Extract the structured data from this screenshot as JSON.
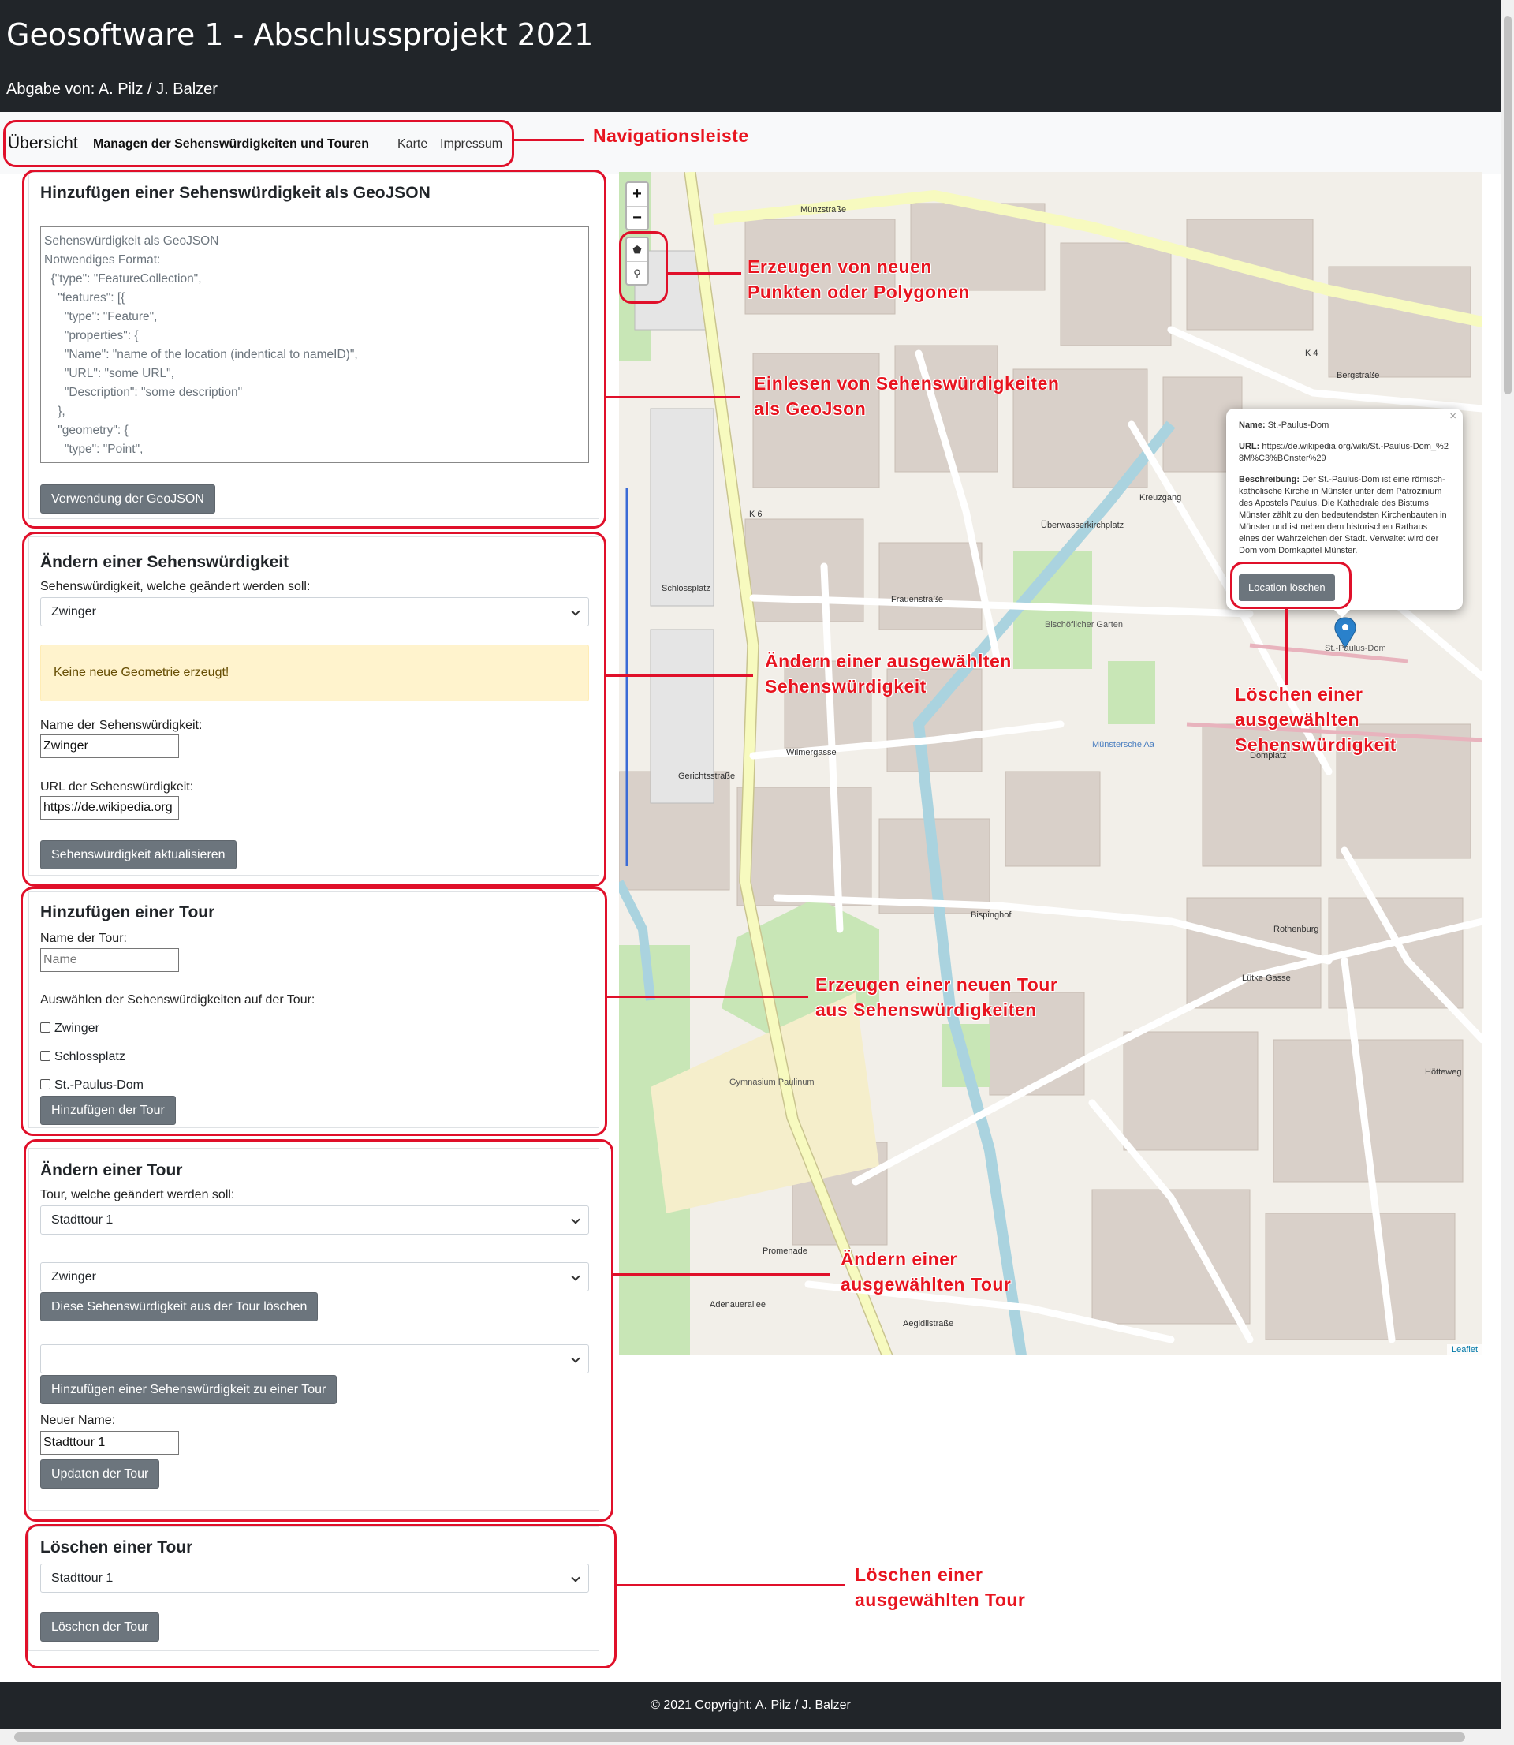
{
  "header": {
    "title": "Geosoftware 1 - Abschlussprojekt 2021",
    "subtitle": "Abgabe von: A. Pilz / J. Balzer"
  },
  "nav": {
    "brand": "Übersicht",
    "items": [
      {
        "label": "Managen der Sehenswürdigkeiten und Touren",
        "active": true
      },
      {
        "label": "Karte",
        "active": false
      },
      {
        "label": "Impressum",
        "active": false
      }
    ]
  },
  "add_sight": {
    "title": "Hinzufügen einer Sehenswürdigkeit als GeoJSON",
    "placeholder": "Sehenswürdigkeit als GeoJSON\nNotwendiges Format:\n  {\"type\": \"FeatureCollection\",\n    \"features\": [{\n      \"type\": \"Feature\",\n      \"properties\": {\n      \"Name\": \"name of the location (indentical to nameID)\",\n      \"URL\": \"some URL\",\n      \"Description\": \"some description\"\n    },\n    \"geometry\": {\n      \"type\": \"Point\",",
    "button": "Verwendung der GeoJSON"
  },
  "edit_sight": {
    "title": "Ändern einer Sehenswürdigkeit",
    "select_label": "Sehenswürdigkeit, welche geändert werden soll:",
    "selected": "Zwinger",
    "alert": "Keine neue Geometrie erzeugt!",
    "name_label": "Name der Sehenswürdigkeit:",
    "name_value": "Zwinger",
    "url_label": "URL der Sehenswürdigkeit:",
    "url_value": "https://de.wikipedia.org",
    "button": "Sehenswürdigkeit aktualisieren"
  },
  "add_tour": {
    "title": "Hinzufügen einer Tour",
    "name_label": "Name der Tour:",
    "name_placeholder": "Name",
    "select_label": "Auswählen der Sehenswürdigkeiten auf der Tour:",
    "options": [
      "Zwinger",
      "Schlossplatz",
      "St.-Paulus-Dom"
    ],
    "button": "Hinzufügen der Tour"
  },
  "edit_tour": {
    "title": "Ändern einer Tour",
    "select_label": "Tour, welche geändert werden soll:",
    "selected_tour": "Stadttour 1",
    "selected_sight": "Zwinger",
    "remove_button": "Diese Sehenswürdigkeit aus der Tour löschen",
    "add_select": "",
    "add_button": "Hinzufügen einer Sehenswürdigkeit zu einer Tour",
    "new_name_label": "Neuer Name:",
    "new_name_value": "Stadttour 1",
    "update_button": "Updaten der Tour"
  },
  "delete_tour": {
    "title": "Löschen einer Tour",
    "selected": "Stadttour 1",
    "button": "Löschen der Tour"
  },
  "map": {
    "zoom_in": "+",
    "zoom_out": "−",
    "draw_tools": [
      "polygon-icon",
      "marker-icon"
    ],
    "popup": {
      "name_label": "Name:",
      "name_value": "St.-Paulus-Dom",
      "url_label": "URL:",
      "url_value": "https://de.wikipedia.org/wiki/St.-Paulus-Dom_%28M%C3%BCnster%29",
      "desc_label": "Beschreibung:",
      "desc_value": "Der St.-Paulus-Dom ist eine römisch-katholische Kirche in Münster unter dem Patrozinium des Apostels Paulus. Die Kathedrale des Bistums Münster zählt zu den bedeutendsten Kirchenbauten in Münster und ist neben dem historischen Rathaus eines der Wahrzeichen der Stadt. Verwaltet wird der Dom vom Domkapitel Münster.",
      "delete_button": "Location löschen",
      "close": "×"
    },
    "attribution": "Leaflet",
    "labels": {
      "muenzstrasse": "Münzstraße",
      "schlossplatz": "Schlossplatz",
      "frauenstrasse": "Frauenstraße",
      "ueberwasserkirchplatz": "Überwasserkirchplatz",
      "kreuzgang": "Kreuzgang",
      "wilmergasse": "Wilmergasse",
      "gerichtsstrasse": "Gerichtsstraße",
      "bispinghof": "Bispinghof",
      "rothenburg": "Rothenburg",
      "luetke_gasse": "Lütke Gasse",
      "promenade": "Promenade",
      "adenauerallee": "Adenauerallee",
      "domplatz": "Domplatz",
      "bergstrasse": "Bergstraße",
      "aegidiistrasse": "Aegidiistraße",
      "st_paulus_dom": "St.-Paulus-Dom",
      "gymnasium": "Gymnasium Paulinum",
      "bischoeflicher_garten": "Bischöflicher Garten",
      "muenster_aa": "Münstersche Aa",
      "hoetteweg": "Hötteweg",
      "k4": "K 4",
      "k6": "K 6"
    }
  },
  "annotations": {
    "navigationsleiste": "Navigationsleiste",
    "erzeugen_punkte": [
      "Erzeugen von neuen",
      "Punkten oder Polygonen"
    ],
    "einlesen": [
      "Einlesen von Sehenswürdigkeiten",
      "als GeoJson"
    ],
    "aendern_sight": [
      "Ändern einer ausgewählten",
      "Sehenswürdigkeit"
    ],
    "loeschen_sight": [
      "Löschen einer",
      "ausgewählten",
      "Sehenswürdigkeit"
    ],
    "erzeugen_tour": [
      "Erzeugen einer neuen Tour",
      "aus Sehenswürdigkeiten"
    ],
    "aendern_tour": [
      "Ändern einer",
      "ausgewählten Tour"
    ],
    "loeschen_tour": [
      "Löschen einer",
      "ausgewählten Tour"
    ]
  },
  "footer": "© 2021 Copyright: A. Pilz / J. Balzer",
  "colors": {
    "header_bg": "#212529",
    "annotation_red": "#e0102a",
    "button_gray": "#6c757d",
    "alert_bg": "#fff3cd"
  }
}
